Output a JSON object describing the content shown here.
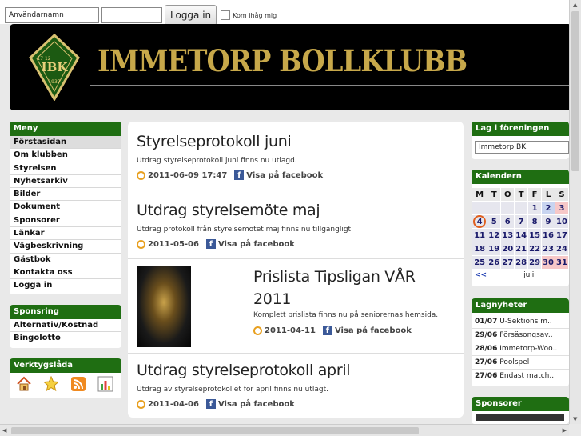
{
  "login": {
    "username_placeholder": "Användarnamn",
    "password_value": "",
    "button_label": "Logga in",
    "remember_label": "Kom ihåg mig"
  },
  "banner": {
    "title": "IMMETORP BOLLKLUBB",
    "logo_text": "IBK",
    "logo_year_top": "17 12",
    "logo_year_bottom": "1937"
  },
  "menu": {
    "title": "Meny",
    "items": [
      "Förstasidan",
      "Om klubben",
      "Styrelsen",
      "Nyhetsarkiv",
      "Bilder",
      "Dokument",
      "Sponsorer",
      "Länkar",
      "Vägbeskrivning",
      "Gästbok",
      "Kontakta oss",
      "Logga in"
    ]
  },
  "sponsring": {
    "title": "Sponsring",
    "items": [
      "Alternativ/Kostnad",
      "Bingolotto"
    ]
  },
  "tools": {
    "title": "Verktygslåda",
    "icons": [
      "home-icon",
      "star-icon",
      "rss-icon",
      "chart-icon"
    ]
  },
  "posts": [
    {
      "title": "Styrelseprotokoll juni",
      "excerpt": "Utdrag styrelseprotokoll juni finns nu utlagd.",
      "date": "2011-06-09 17:47",
      "share": "Visa på facebook"
    },
    {
      "title": "Utdrag styrelsemöte maj",
      "excerpt": "Utdrag protokoll från styrelsemötet maj finns nu tillgängligt.",
      "date": "2011-05-06",
      "share": "Visa på facebook"
    },
    {
      "title": "Prislista Tipsligan VÅR 2011",
      "excerpt": "Komplett prislista finns nu på seniorernas hemsida.",
      "date": "2011-04-11",
      "share": "Visa på facebook"
    },
    {
      "title": "Utdrag styrelseprotokoll april",
      "excerpt": "Utdrag av styrelseprotokollet för april finns nu utlagt.",
      "date": "2011-04-06",
      "share": "Visa på facebook"
    }
  ],
  "teams": {
    "title": "Lag i föreningen",
    "selected": "Immetorp BK"
  },
  "calendar": {
    "title": "Kalendern",
    "days": [
      "M",
      "T",
      "O",
      "T",
      "F",
      "L",
      "S"
    ],
    "weeks": [
      [
        "",
        "",
        "",
        "",
        "1",
        "2",
        "3"
      ],
      [
        "4",
        "5",
        "6",
        "7",
        "8",
        "9",
        "10"
      ],
      [
        "11",
        "12",
        "13",
        "14",
        "15",
        "16",
        "17"
      ],
      [
        "18",
        "19",
        "20",
        "21",
        "22",
        "23",
        "24"
      ],
      [
        "25",
        "26",
        "27",
        "28",
        "29",
        "30",
        "31"
      ]
    ],
    "prev": "<<",
    "month": "juli"
  },
  "news": {
    "title": "Lagnyheter",
    "items": [
      {
        "date": "01/07",
        "text": "U-Sektions m.."
      },
      {
        "date": "29/06",
        "text": "Försäsongsav.."
      },
      {
        "date": "28/06",
        "text": "Immetorp-Woo.."
      },
      {
        "date": "27/06",
        "text": "Poolspel"
      },
      {
        "date": "27/06",
        "text": "Endast match.."
      }
    ]
  },
  "sponsors": {
    "title": "Sponsorer"
  },
  "colors": {
    "brand_green": "#1f6e12",
    "banner_gold": "#c7a84a",
    "banner_bg": "#000000"
  }
}
